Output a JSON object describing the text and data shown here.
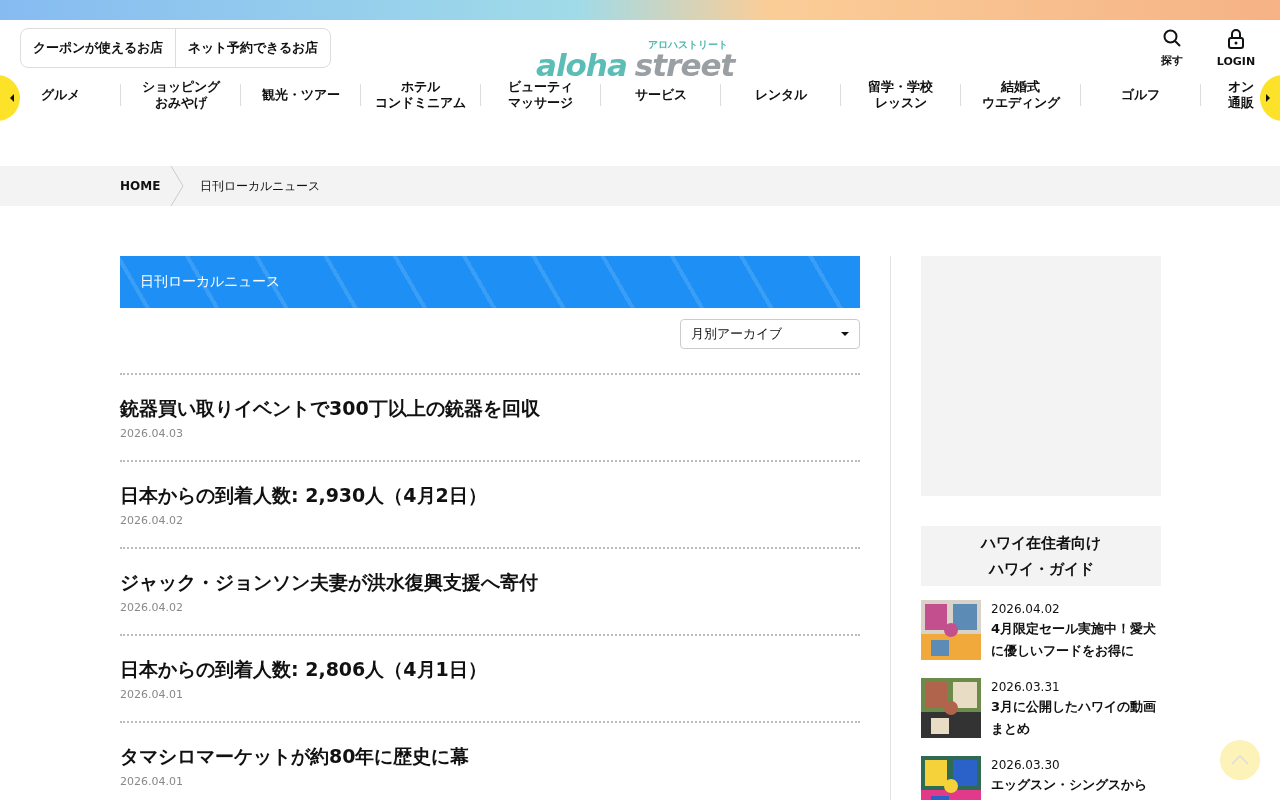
{
  "header": {
    "filters": [
      "クーポンが使えるお店",
      "ネット予約できるお店"
    ],
    "logo": {
      "main_left": "aloha",
      "main_right": "street",
      "sub": "アロハストリート"
    },
    "actions": [
      {
        "kind": "search",
        "label": "探す"
      },
      {
        "kind": "login",
        "label": "LOGIN"
      }
    ]
  },
  "nav": [
    {
      "lines": [
        "グルメ"
      ]
    },
    {
      "lines": [
        "ショッピング",
        "おみやげ"
      ]
    },
    {
      "lines": [
        "観光・ツアー"
      ]
    },
    {
      "lines": [
        "ホテル",
        "コンドミニアム"
      ]
    },
    {
      "lines": [
        "ビューティ",
        "マッサージ"
      ]
    },
    {
      "lines": [
        "サービス"
      ]
    },
    {
      "lines": [
        "レンタル"
      ]
    },
    {
      "lines": [
        "留学・学校",
        "レッスン"
      ]
    },
    {
      "lines": [
        "結婚式",
        "ウエディング"
      ]
    },
    {
      "lines": [
        "ゴルフ"
      ]
    },
    {
      "lines": [
        "オン",
        "通販"
      ]
    }
  ],
  "breadcrumb": [
    "HOME",
    "日刊ローカルニュース"
  ],
  "section_title": "日刊ローカルニュース",
  "archive_select": {
    "value": "月別アーカイブ"
  },
  "articles": [
    {
      "title": "銃器買い取りイベントで300丁以上の銃器を回収",
      "date": "2026.04.03"
    },
    {
      "title": "日本からの到着人数: 2,930人（4月2日）",
      "date": "2026.04.02"
    },
    {
      "title": "ジャック・ジョンソン夫妻が洪水復興支援へ寄付",
      "date": "2026.04.02"
    },
    {
      "title": "日本からの到着人数: 2,806人（4月1日）",
      "date": "2026.04.01"
    },
    {
      "title": "タマシロマーケットが約80年に歴史に幕",
      "date": "2026.04.01"
    }
  ],
  "sidebar": {
    "guide_title": [
      "ハワイ在住者向け",
      "ハワイ・ガイド"
    ],
    "posts": [
      {
        "date": "2026.04.02",
        "title": "4月限定セール実施中！愛犬に優しいフードをお得に"
      },
      {
        "date": "2026.03.31",
        "title": "3月に公開したハワイの動画まとめ"
      },
      {
        "date": "2026.03.30",
        "title": "エッグスン・シングスから"
      }
    ]
  }
}
